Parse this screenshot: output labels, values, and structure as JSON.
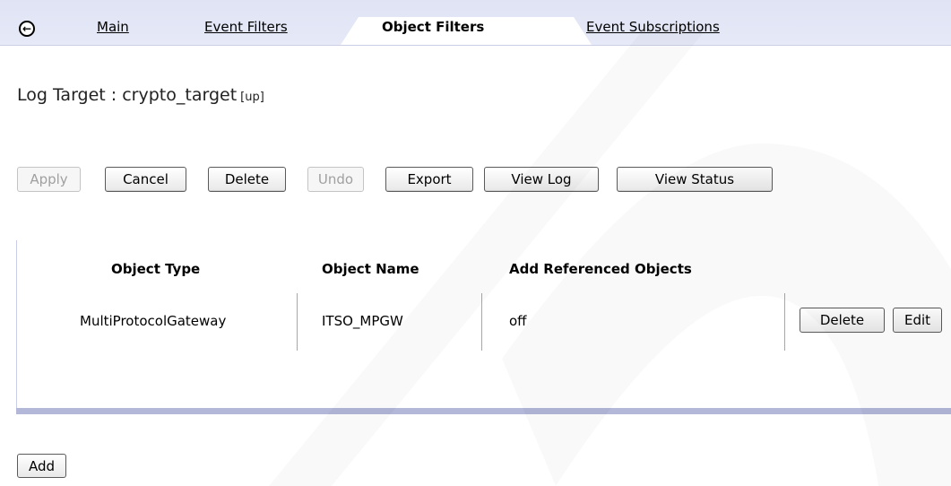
{
  "tabs": {
    "back_icon": "back-arrow-icon",
    "items": [
      {
        "label": "Main"
      },
      {
        "label": "Event Filters"
      },
      {
        "label": "Object Filters"
      },
      {
        "label": "Event Subscriptions"
      }
    ]
  },
  "heading": {
    "title": "Log Target : crypto_target",
    "status": "[up]"
  },
  "toolbar": {
    "apply": "Apply",
    "cancel": "Cancel",
    "delete": "Delete",
    "undo": "Undo",
    "export": "Export",
    "view_log": "View Log",
    "view_status": "View Status"
  },
  "table": {
    "columns": [
      "Object Type",
      "Object Name",
      "Add Referenced Objects"
    ],
    "rows": [
      {
        "object_type": "MultiProtocolGateway",
        "object_name": "ITSO_MPGW",
        "add_referenced": "off",
        "delete_label": "Delete",
        "edit_label": "Edit"
      }
    ]
  },
  "add_label": "Add"
}
